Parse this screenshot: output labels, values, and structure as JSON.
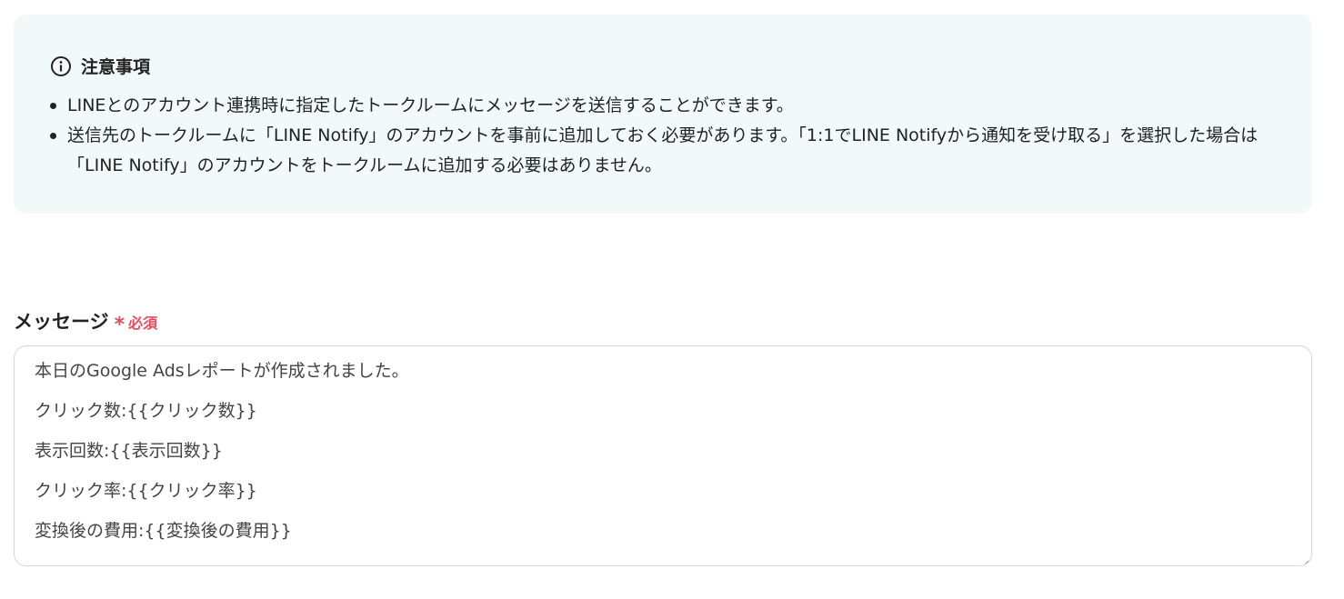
{
  "notice": {
    "title": "注意事項",
    "icon": "info-icon",
    "items": [
      "LINEとのアカウント連携時に指定したトークルームにメッセージを送信することができます。",
      "送信先のトークルームに「LINE Notify」のアカウントを事前に追加しておく必要があります。「1:1でLINE Notifyから通知を受け取る」を選択した場合は「LINE Notify」のアカウントをトークルームに追加する必要はありません。"
    ]
  },
  "message_field": {
    "label": "メッセージ",
    "required_mark": "*",
    "required_text": "必須",
    "lines": [
      "本日のGoogle Adsレポートが作成されました。",
      "クリック数:{{クリック数}}",
      "表示回数:{{表示回数}}",
      "クリック率:{{クリック率}}",
      "変換後の費用:{{変換後の費用}}"
    ]
  },
  "colors": {
    "notice_bg": "#f1f9f9",
    "required": "#e54b5c",
    "border": "#d6d6d6"
  }
}
